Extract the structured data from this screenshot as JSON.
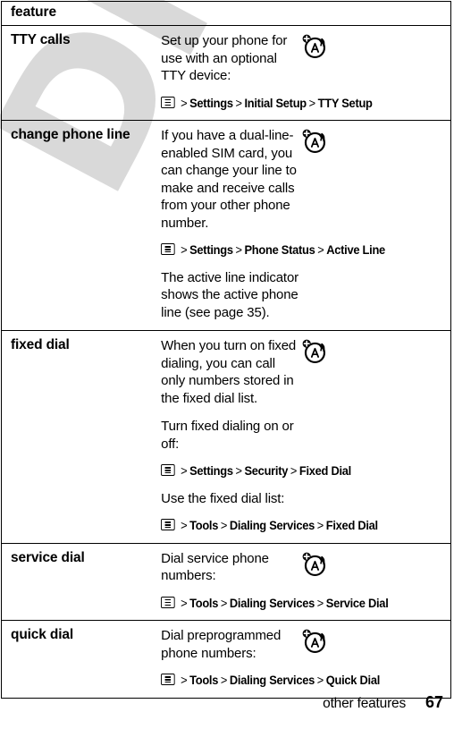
{
  "watermark": {
    "text": "DRAFT",
    "color": "#d9d9d9"
  },
  "table": {
    "header": {
      "label": "feature"
    },
    "icon_names": {
      "menu_key": "menu-key-icon",
      "network": "network-a-icon"
    },
    "separator": ">",
    "rows": [
      {
        "name": "TTY calls",
        "icon": "network-a-icon",
        "blocks": [
          {
            "type": "text",
            "text": "Set up your phone for use with an optional TTY device:"
          },
          {
            "type": "path",
            "items": [
              "Settings",
              "Initial Setup",
              "TTY Setup"
            ]
          }
        ]
      },
      {
        "name": "change phone line",
        "icon": "network-a-icon",
        "blocks": [
          {
            "type": "text",
            "text": "If you have a dual-line-enabled SIM card, you can change your line to make and receive calls from your other phone number."
          },
          {
            "type": "path",
            "items": [
              "Settings",
              "Phone Status",
              "Active Line"
            ]
          },
          {
            "type": "text",
            "text": "The active line indicator shows the active phone line (see page 35)."
          }
        ]
      },
      {
        "name": "fixed dial",
        "icon": "network-a-icon",
        "blocks": [
          {
            "type": "text",
            "text": "When you turn on fixed dialing, you can call only numbers stored in the fixed dial list."
          },
          {
            "type": "text",
            "text": "Turn fixed dialing on or off:"
          },
          {
            "type": "path",
            "items": [
              "Settings",
              "Security",
              "Fixed Dial"
            ]
          },
          {
            "type": "text",
            "text": "Use the fixed dial list:"
          },
          {
            "type": "path",
            "items": [
              "Tools",
              "Dialing Services",
              "Fixed Dial"
            ]
          }
        ]
      },
      {
        "name": "service dial",
        "icon": "network-a-icon",
        "blocks": [
          {
            "type": "text",
            "text": "Dial service phone numbers:"
          },
          {
            "type": "path",
            "items": [
              "Tools",
              "Dialing Services",
              "Service Dial"
            ]
          }
        ]
      },
      {
        "name": "quick dial",
        "icon": "network-a-icon",
        "blocks": [
          {
            "type": "text",
            "text": "Dial preprogrammed phone numbers:"
          },
          {
            "type": "path",
            "items": [
              "Tools",
              "Dialing Services",
              "Quick Dial"
            ]
          }
        ]
      }
    ]
  },
  "footer": {
    "section_title": "other features",
    "page_number": "67"
  }
}
